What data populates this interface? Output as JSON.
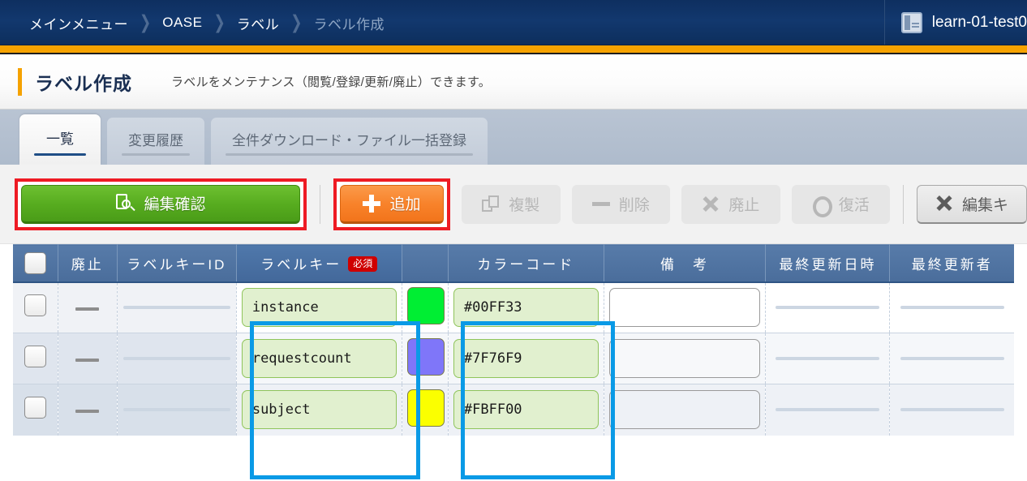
{
  "topbar": {
    "breadcrumb": [
      {
        "label": "メインメニュー",
        "dim": false
      },
      {
        "label": "OASE",
        "dim": false
      },
      {
        "label": "ラベル",
        "dim": false
      },
      {
        "label": "ラベル作成",
        "dim": true
      }
    ],
    "separator": "❯",
    "user_name": "learn-01-test0",
    "user_icon": "panel-icon",
    "accent_color": "#f5a200",
    "bar_color": "#12386e"
  },
  "page": {
    "title": "ラベル作成",
    "description": "ラベルをメンテナンス（閲覧/登録/更新/廃止）できます。"
  },
  "tabs": [
    {
      "label": "一覧",
      "active": true
    },
    {
      "label": "変更履歴",
      "active": false
    },
    {
      "label": "全件ダウンロード・ファイル一括登録",
      "active": false
    }
  ],
  "toolbar": {
    "confirm_edit": {
      "label": "編集確認",
      "icon": "doc-search-icon",
      "state": "enabled",
      "color": "#57ac1f",
      "highlight": "#ee1b24"
    },
    "add": {
      "label": "追加",
      "icon": "plus-icon",
      "state": "enabled",
      "color": "#f8822a",
      "highlight": "#ee1b24"
    },
    "duplicate": {
      "label": "複製",
      "icon": "copy-icon",
      "state": "disabled"
    },
    "delete": {
      "label": "削除",
      "icon": "minus-icon",
      "state": "disabled"
    },
    "abolish": {
      "label": "廃止",
      "icon": "x-icon",
      "state": "disabled"
    },
    "restore": {
      "label": "復活",
      "icon": "circle-icon",
      "state": "disabled"
    },
    "cancel_edit": {
      "label": "編集キ",
      "icon": "x-icon",
      "state": "enabled"
    }
  },
  "table": {
    "columns": [
      {
        "key": "select",
        "label": "",
        "icon": "select-all-checkbox"
      },
      {
        "key": "abolished",
        "label": "廃止"
      },
      {
        "key": "label_key_id",
        "label": "ラベルキーID"
      },
      {
        "key": "label_key",
        "label": "ラベルキー",
        "badge": "必須",
        "highlighted": true
      },
      {
        "key": "color_swatch",
        "label": ""
      },
      {
        "key": "color_code",
        "label": "カラーコード"
      },
      {
        "key": "note",
        "label": "備　考"
      },
      {
        "key": "last_updated",
        "label": "最終更新日時"
      },
      {
        "key": "last_updater",
        "label": "最終更新者"
      }
    ],
    "rows": [
      {
        "selected": false,
        "abolished": "—",
        "label_key_id": "",
        "label_key": "instance",
        "swatch_color": "#00EE33",
        "color_code": "#00FF33",
        "note": "",
        "last_updated": "",
        "last_updater": ""
      },
      {
        "selected": false,
        "abolished": "—",
        "label_key_id": "",
        "label_key": "requestcount",
        "swatch_color": "#7F76F9",
        "color_code": "#7F76F9",
        "note": "",
        "last_updated": "",
        "last_updater": ""
      },
      {
        "selected": false,
        "abolished": "—",
        "label_key_id": "",
        "label_key": "subject",
        "swatch_color": "#FBFF00",
        "color_code": "#FBFF00",
        "note": "",
        "last_updated": "",
        "last_updater": ""
      }
    ]
  },
  "annotations": {
    "blue_highlight_color": "#0a9ae6",
    "red_highlight_color": "#ee1b24"
  }
}
